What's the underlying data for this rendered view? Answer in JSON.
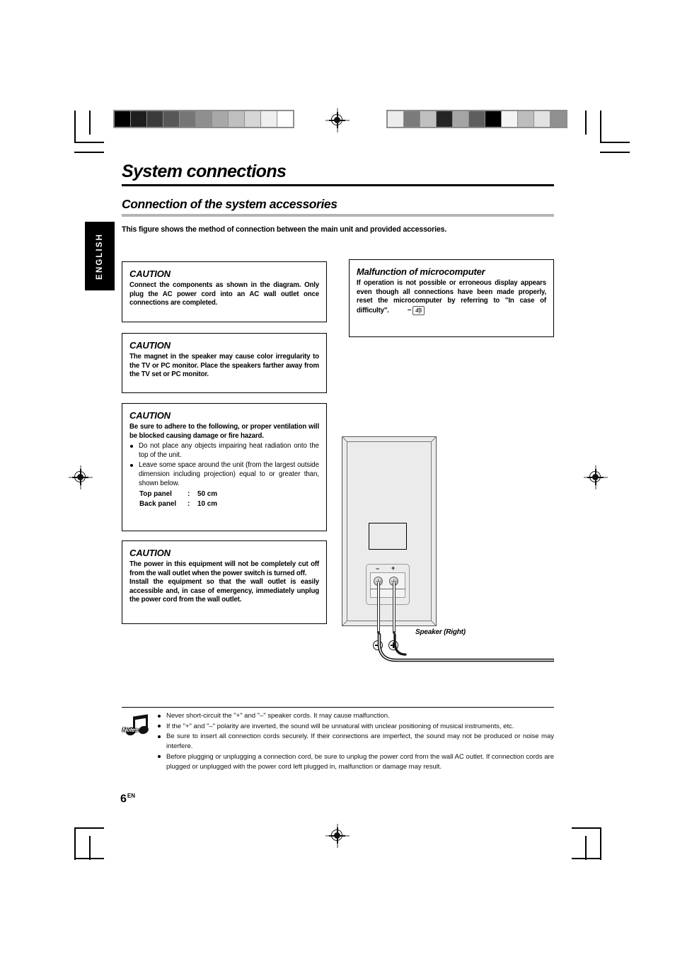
{
  "page": {
    "language_tab": "ENGLISH",
    "number": "6",
    "number_suffix": "EN"
  },
  "header": {
    "title": "System connections",
    "section_title": "Connection of the system accessories",
    "intro": "This figure shows the method of connection between the main unit and provided accessories."
  },
  "caution_boxes": [
    {
      "heading": "CAUTION",
      "paragraphs": [
        "Connect the components as shown in the diagram. Only plug the AC  power cord into an AC wall outlet once connections are completed."
      ]
    },
    {
      "heading": "CAUTION",
      "paragraphs": [
        "The magnet in the speaker may cause color irregularity to the TV or PC monitor. Place the speakers farther away from the TV set or PC monitor."
      ]
    },
    {
      "heading": "CAUTION",
      "paragraphs": [
        "Be sure to adhere to the following, or proper ventilation will be blocked causing damage or fire hazard."
      ],
      "bullets": [
        "Do not place any objects impairing heat radiation onto the top of the unit.",
        "Leave some space around the unit (from the largest outside dimension including projection) equal to or greater than, shown below."
      ],
      "spec_rows": [
        {
          "label": "Top panel",
          "colon": ":",
          "value": "50 cm"
        },
        {
          "label": "Back panel",
          "colon": ":",
          "value": "10 cm"
        }
      ]
    },
    {
      "heading": "CAUTION",
      "paragraphs": [
        "The power in this equipment will not be completely cut off from the wall outlet when the power switch is turned off.",
        "Install the equipment so that the wall outlet is easily accessible and, in case of emergency, immediately unplug the power cord from the wall outlet."
      ]
    }
  ],
  "microcomputer_box": {
    "heading": "Malfunction of microcomputer",
    "body": "If operation is not possible or erroneous display appears even though all connections have been made properly, reset the microcomputer by referring to \"In case of difficulty\".",
    "page_ref": {
      "arrow": "–",
      "page": "46",
      "icon": "book-icon"
    }
  },
  "figure": {
    "caption": "Speaker (Right)",
    "terminal_minus": "−",
    "terminal_plus": "+",
    "polarity_minus": "minus-circle-icon",
    "polarity_plus": "plus-circle-icon"
  },
  "notes": {
    "icon_label": "Notes",
    "items": [
      "Never short-circuit the \"+\" and \"–\" speaker cords. It may cause malfunction.",
      "If the \"+\" and \"–\" polarity are inverted, the sound will be unnatural with unclear positioning of musical instruments, etc.",
      "Be sure to insert all connection cords securely. If their connections are imperfect, the sound may not be produced or noise may interfere.",
      "Before plugging or unplugging a connection cord, be sure to unplug the power cord from the wall AC outlet. If connection cords are plugged or unplugged with the power cord left plugged in, malfunction or damage may result."
    ]
  },
  "print_marks": {
    "wedge_left": [
      "#000000",
      "#1f1f1f",
      "#3b3b3b",
      "#575757",
      "#767676",
      "#8f8f8f",
      "#a8a8a8",
      "#bfbfbf",
      "#d6d6d6",
      "#efefef",
      "#ffffff"
    ],
    "wedge_right": [
      "#ececec",
      "#7b7b7b",
      "#c0c0c0",
      "#252525",
      "#a5a5a5",
      "#5e5e5e",
      "#000000",
      "#f4f4f4",
      "#bdbdbd",
      "#e2e2e2",
      "#909090"
    ]
  }
}
